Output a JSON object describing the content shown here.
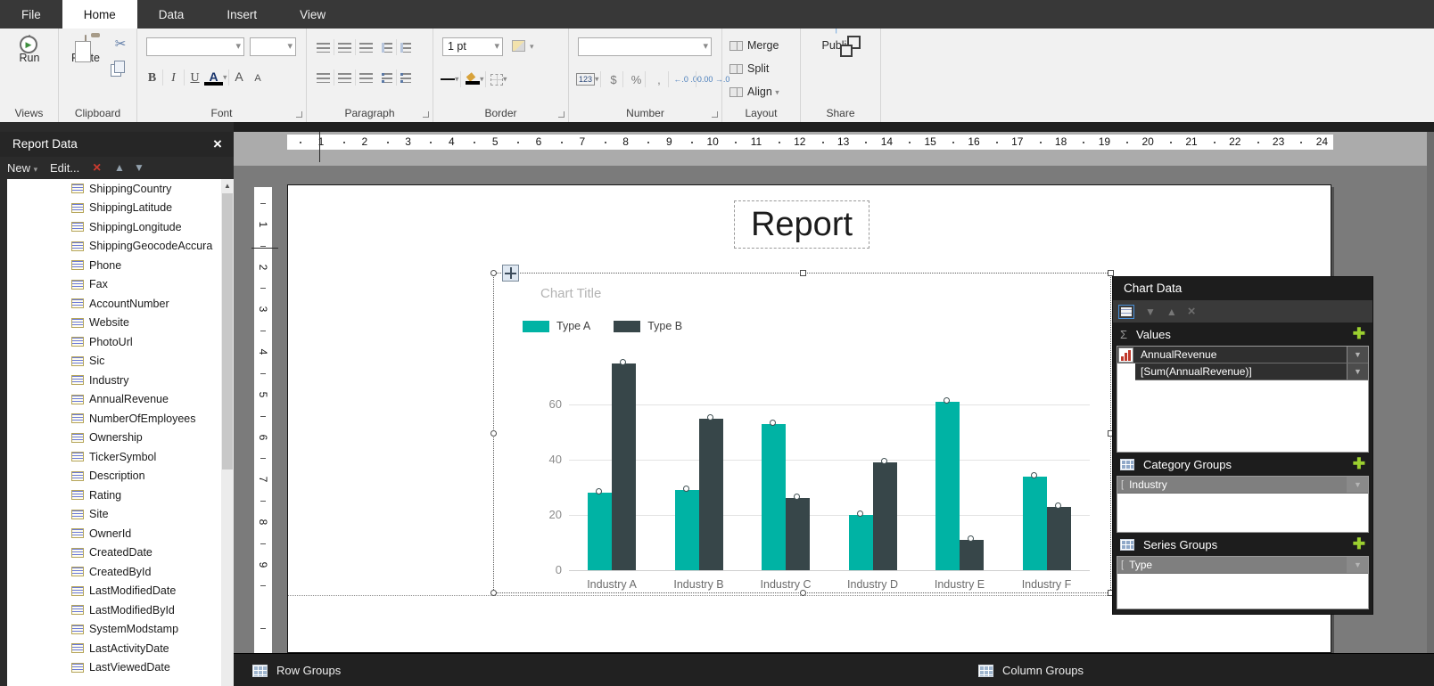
{
  "menu": {
    "tabs": [
      {
        "label": "File",
        "active": false
      },
      {
        "label": "Home",
        "active": true
      },
      {
        "label": "Data",
        "active": false
      },
      {
        "label": "Insert",
        "active": false
      },
      {
        "label": "View",
        "active": false
      }
    ]
  },
  "ribbon": {
    "views": {
      "label": "Views",
      "run": "Run"
    },
    "clipboard": {
      "label": "Clipboard",
      "paste": "Paste"
    },
    "font": {
      "label": "Font",
      "bold": "B",
      "italic": "I",
      "underline": "U",
      "color": "A",
      "grow": "A",
      "shrink": "A"
    },
    "paragraph": {
      "label": "Paragraph"
    },
    "border": {
      "label": "Border",
      "width_value": "1 pt"
    },
    "number": {
      "label": "Number",
      "format": "123",
      "currency": "$",
      "percent": "%",
      "comma": ",",
      "inc_decimal": "←.0 .00",
      "dec_decimal": ".00 →.0"
    },
    "layout": {
      "label": "Layout",
      "merge": "Merge",
      "split": "Split",
      "align": "Align"
    },
    "share": {
      "label": "Share",
      "publish": "Publish"
    }
  },
  "report_data": {
    "title": "Report Data",
    "new_label": "New",
    "edit_label": "Edit...",
    "fields": [
      "ShippingCountry",
      "ShippingLatitude",
      "ShippingLongitude",
      "ShippingGeocodeAccura",
      "Phone",
      "Fax",
      "AccountNumber",
      "Website",
      "PhotoUrl",
      "Sic",
      "Industry",
      "AnnualRevenue",
      "NumberOfEmployees",
      "Ownership",
      "TickerSymbol",
      "Description",
      "Rating",
      "Site",
      "OwnerId",
      "CreatedDate",
      "CreatedById",
      "LastModifiedDate",
      "LastModifiedById",
      "SystemModstamp",
      "LastActivityDate",
      "LastViewedDate"
    ]
  },
  "rulers": {
    "horizontal": [
      1,
      2,
      3,
      4,
      5,
      6,
      7,
      8,
      9,
      10,
      11,
      12,
      13,
      14,
      15,
      16,
      17,
      18,
      19,
      20,
      21,
      22,
      23,
      24
    ],
    "vertical": [
      1,
      2,
      3,
      4,
      5,
      6,
      7,
      8,
      9
    ]
  },
  "page": {
    "report_title": "Report"
  },
  "chart_data": {
    "type": "bar",
    "title": "Chart Title",
    "categories": [
      "Industry A",
      "Industry B",
      "Industry C",
      "Industry D",
      "Industry E",
      "Industry F"
    ],
    "series": [
      {
        "name": "Type A",
        "color": "#00b3a4",
        "values": [
          28,
          29,
          53,
          20,
          61,
          34
        ]
      },
      {
        "name": "Type B",
        "color": "#374649",
        "values": [
          75,
          55,
          26,
          39,
          11,
          23
        ]
      }
    ],
    "yticks": [
      0,
      20,
      40,
      60
    ],
    "ylim": [
      0,
      80
    ],
    "grid": true,
    "legend_position": "top-left"
  },
  "chart_panel": {
    "title": "Chart Data",
    "values_label": "Values",
    "values_rows": [
      "AnnualRevenue",
      "[Sum(AnnualRevenue)]"
    ],
    "category_label": "Category Groups",
    "category_rows": [
      "Industry"
    ],
    "series_label": "Series Groups",
    "series_rows": [
      "Type"
    ]
  },
  "bottom_bar": {
    "row_groups": "Row Groups",
    "column_groups": "Column Groups"
  },
  "colors": {
    "accent_teal": "#00b3a4",
    "accent_slate": "#374649",
    "plus_green": "#9bcf2f",
    "delete_red": "#cc3b2f"
  }
}
